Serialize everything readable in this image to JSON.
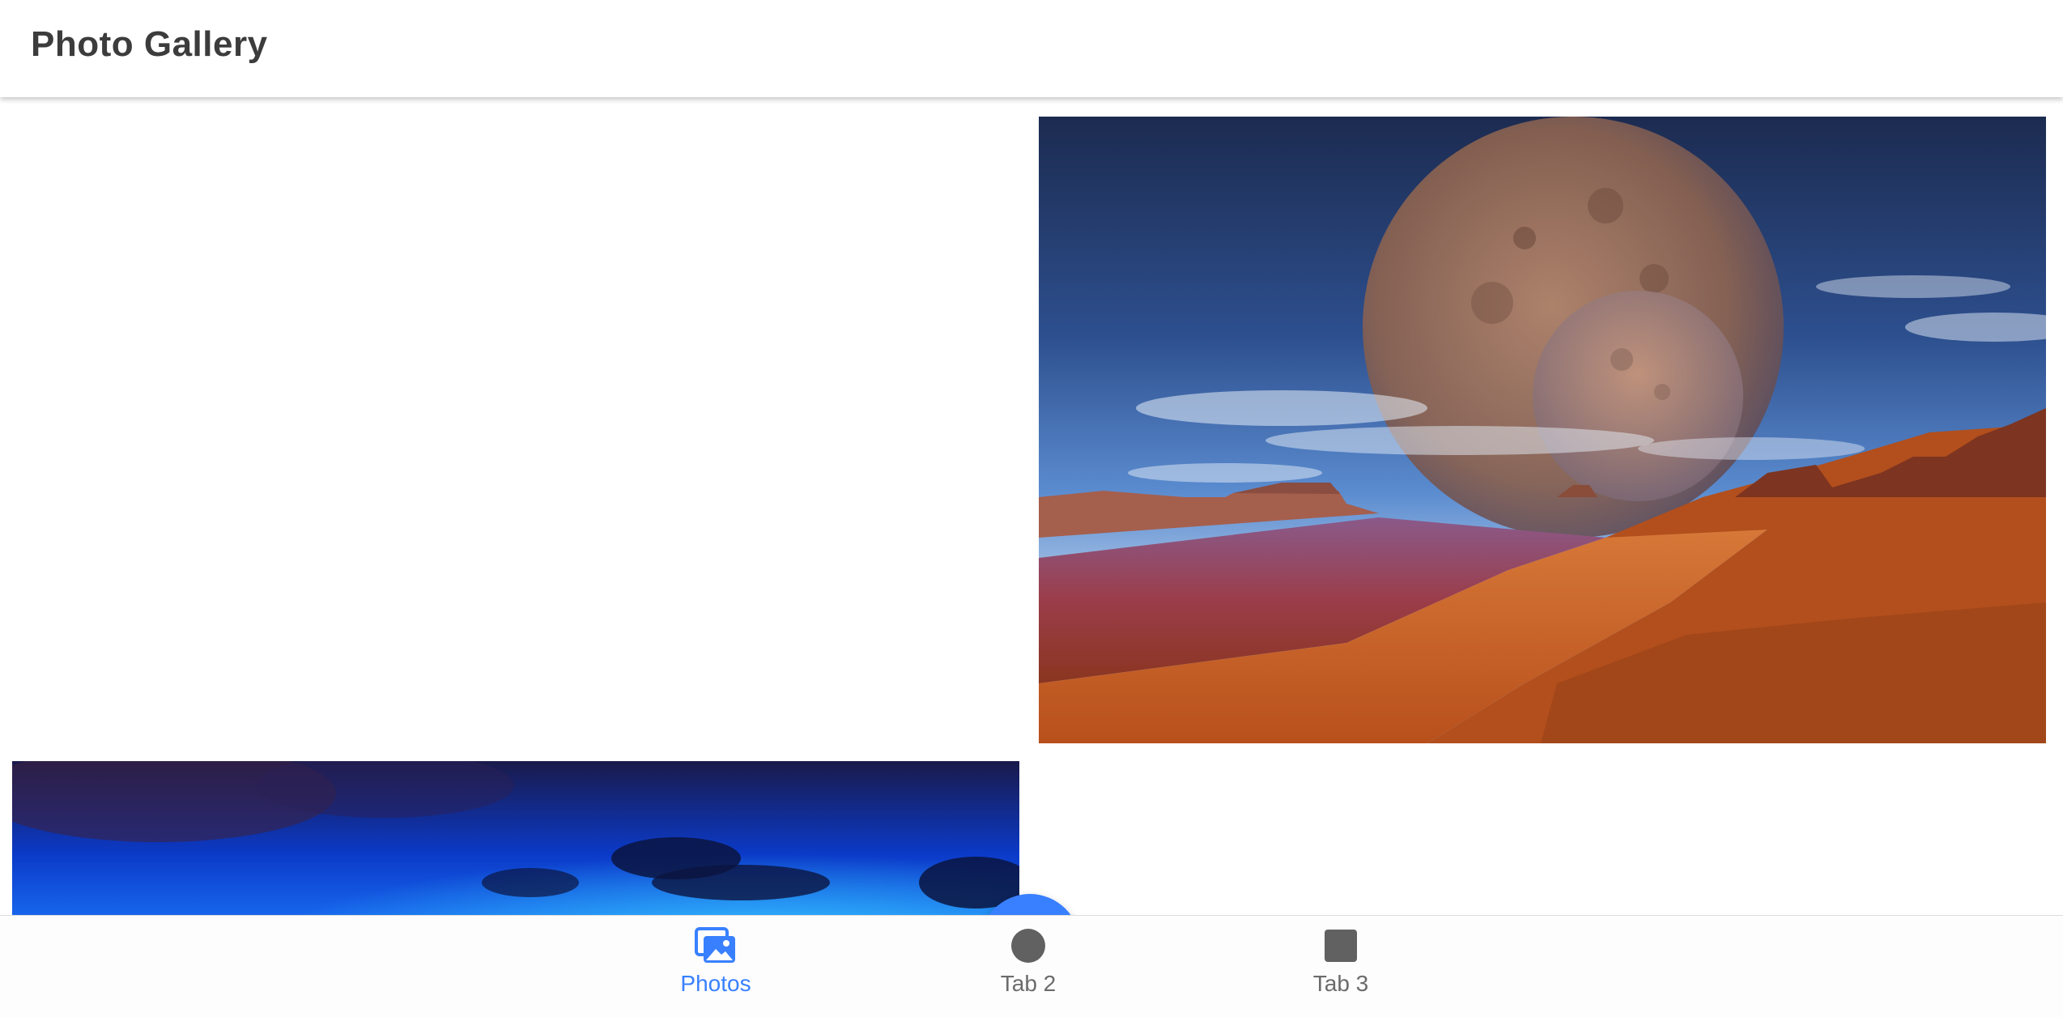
{
  "app": {
    "title": "Photo Gallery"
  },
  "gallery": {
    "photos": [
      {
        "description_icon": "photo-planet-desert"
      },
      {
        "description_icon": "photo-blue-sky"
      }
    ]
  },
  "fab": {
    "icon": "camera-icon",
    "color": "#3880ff"
  },
  "tabs": [
    {
      "label": "Photos",
      "icon": "images-icon",
      "active": true
    },
    {
      "label": "Tab 2",
      "icon": "ellipse-icon",
      "active": false
    },
    {
      "label": "Tab 3",
      "icon": "square-icon",
      "active": false
    }
  ],
  "colors": {
    "accent": "#3880ff",
    "inactive_tab": "#6b6b6b",
    "title_text": "#3c3c3c"
  }
}
